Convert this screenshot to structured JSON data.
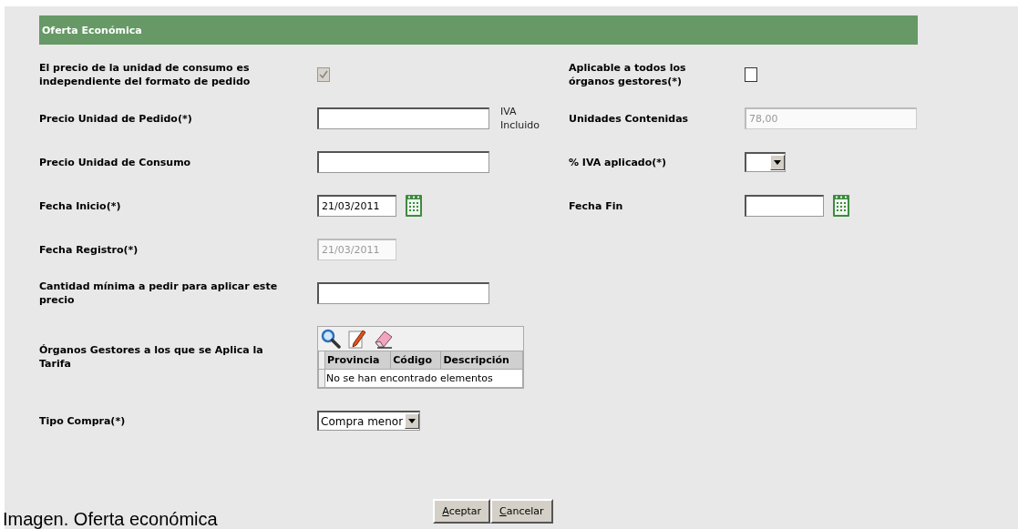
{
  "section": {
    "title": "Oferta Económica"
  },
  "rows": [
    {
      "cells": [
        {
          "kind": "checkbox",
          "label": "El precio de la unidad de consumo es independiente del formato de pedido",
          "checked": true,
          "disabled": true
        },
        {
          "kind": "checkbox",
          "label": "Aplicable a todos los órganos gestores(*)",
          "checked": false,
          "disabled": false
        }
      ]
    },
    {
      "cells": [
        {
          "kind": "text",
          "label": "Precio Unidad de Pedido(*)",
          "note": "IVA Incluido",
          "disabled": false
        },
        {
          "kind": "text",
          "label": "Unidades Contenidas",
          "value": "78,00",
          "disabled": true
        }
      ]
    },
    {
      "cells": [
        {
          "kind": "text",
          "label": "Precio Unidad de Consumo",
          "disabled": false
        },
        {
          "kind": "select",
          "label": "% IVA aplicado(*)"
        }
      ]
    },
    {
      "cells": [
        {
          "kind": "date",
          "label": "Fecha Inicio(*)",
          "value": "21/03/2011",
          "disabled": false
        },
        {
          "kind": "date",
          "label": "Fecha Fin",
          "disabled": false
        }
      ]
    },
    {
      "cells": [
        {
          "kind": "date",
          "label": "Fecha Registro(*)",
          "value": "21/03/2011",
          "disabled": true
        }
      ]
    },
    {
      "cells": [
        {
          "kind": "text",
          "label": "Cantidad mínima a pedir para aplicar este precio",
          "disabled": false
        }
      ]
    },
    {
      "cells": [
        {
          "kind": "table",
          "label": "Órganos Gestores a los que se Aplica la Tarifa",
          "columns": [
            "Provincia",
            "Código",
            "Descripción"
          ],
          "empty": "No se han encontrado elementos"
        }
      ]
    },
    {
      "cells": [
        {
          "kind": "select",
          "label": "Tipo Compra(*)",
          "value": "Compra menor"
        }
      ]
    }
  ],
  "buttons": [
    "Aceptar",
    "Cancelar"
  ],
  "caption": "Imagen. Oferta económica"
}
